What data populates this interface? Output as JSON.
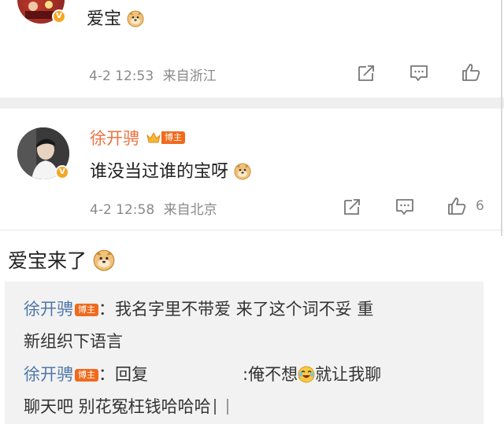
{
  "comment1": {
    "text": "爱宝",
    "time": "4-2 12:53",
    "source": "来自浙江"
  },
  "comment2": {
    "username": "徐开骋",
    "badge": "博主",
    "text": "谁没当过谁的宝呀",
    "time": "4-2 12:58",
    "source": "来自北京",
    "like_count": "6"
  },
  "main_post": {
    "text": "爱宝来了"
  },
  "replies": [
    {
      "username": "徐开骋",
      "badge": "博主",
      "colon": "：",
      "line1": "我名字里不带爱 来了这个词不妥 重",
      "line2": "新组织下语言"
    },
    {
      "username": "徐开骋",
      "badge": "博主",
      "colon": "：",
      "line1a": "回复",
      "line1b": ":俺不想",
      "line1c": "就让我聊",
      "line2": "聊天吧 别花冤枉钱哈哈哈"
    }
  ],
  "colors": {
    "username": "#eb7340",
    "reply_name": "#4d77a8",
    "badge": "#f06a1d",
    "meta": "#8a8a8a",
    "divider": "#f0f0f0"
  },
  "icons": [
    "share-icon",
    "comment-icon",
    "like-icon",
    "verified-icon",
    "doge-emoji",
    "laugh-cry-emoji",
    "crown-icon"
  ]
}
